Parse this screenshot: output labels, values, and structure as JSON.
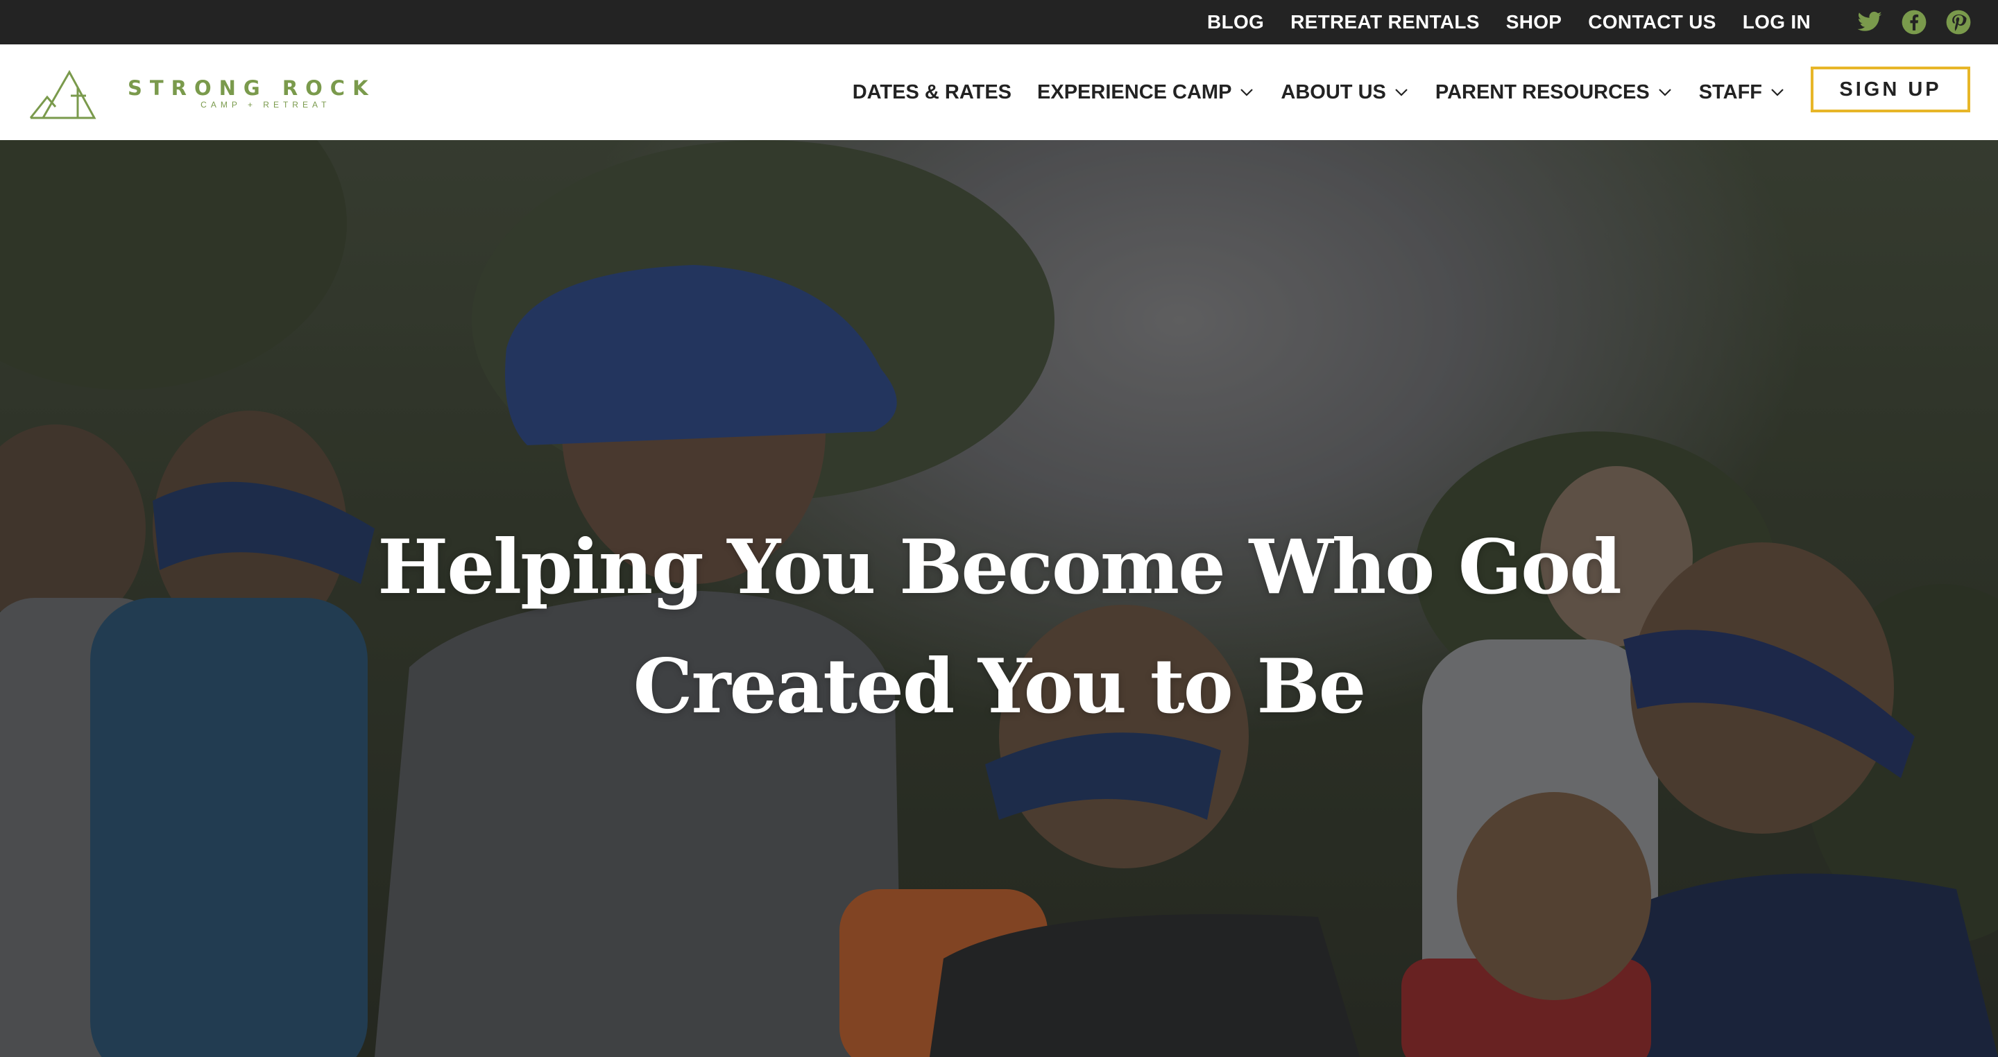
{
  "topbar": {
    "links": [
      "BLOG",
      "RETREAT RENTALS",
      "SHOP",
      "CONTACT US",
      "LOG IN"
    ],
    "social": [
      {
        "icon": "twitter-icon",
        "color": "#7a9a4c"
      },
      {
        "icon": "facebook-icon",
        "color": "#7a9a4c"
      },
      {
        "icon": "pinterest-icon",
        "color": "#7a9a4c"
      }
    ]
  },
  "logo": {
    "main": "STRONG ROCK",
    "sub": "CAMP + RETREAT",
    "color": "#7a9a4c"
  },
  "nav": {
    "items": [
      {
        "label": "DATES & RATES",
        "dropdown": false
      },
      {
        "label": "EXPERIENCE CAMP",
        "dropdown": true
      },
      {
        "label": "ABOUT US",
        "dropdown": true
      },
      {
        "label": "PARENT RESOURCES",
        "dropdown": true
      },
      {
        "label": "STAFF",
        "dropdown": true
      }
    ],
    "signup": "SIGN UP",
    "signup_border_color": "#e7b628"
  },
  "hero": {
    "line1": "Helping You Become Who God",
    "line2": "Created You to Be"
  }
}
